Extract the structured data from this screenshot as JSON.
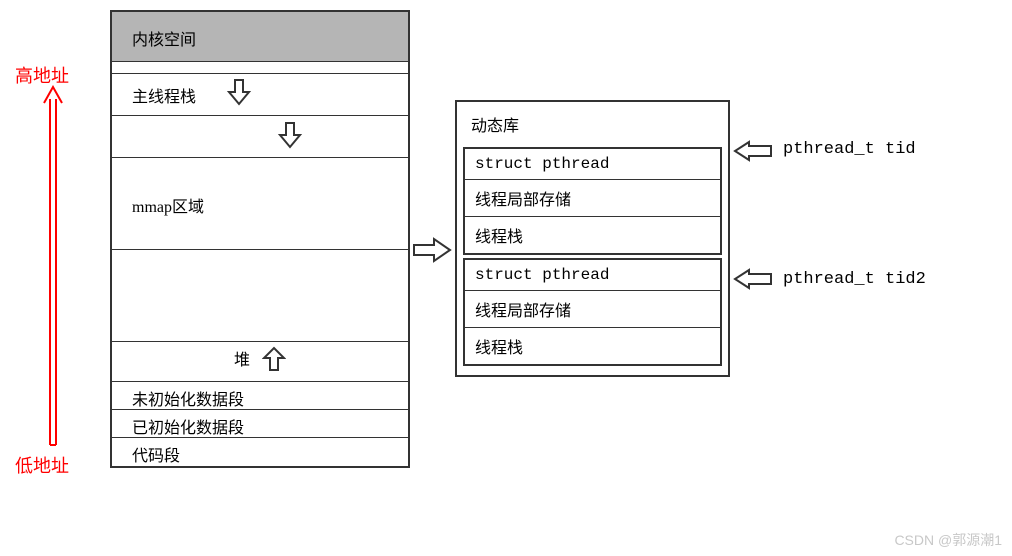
{
  "addr_labels": {
    "high": "高地址",
    "low": "低地址"
  },
  "memory": {
    "kernel": "内核空间",
    "main_stack": "主线程栈",
    "mmap": "mmap区域",
    "heap": "堆",
    "bss": "未初始化数据段",
    "data": "已初始化数据段",
    "code": "代码段"
  },
  "dynlib": {
    "title": "动态库",
    "struct": "struct pthread",
    "tls": "线程局部存储",
    "stack": "线程栈"
  },
  "pointers": {
    "tid1": "pthread_t tid",
    "tid2": "pthread_t tid2"
  },
  "watermark": "CSDN @郭源潮1"
}
